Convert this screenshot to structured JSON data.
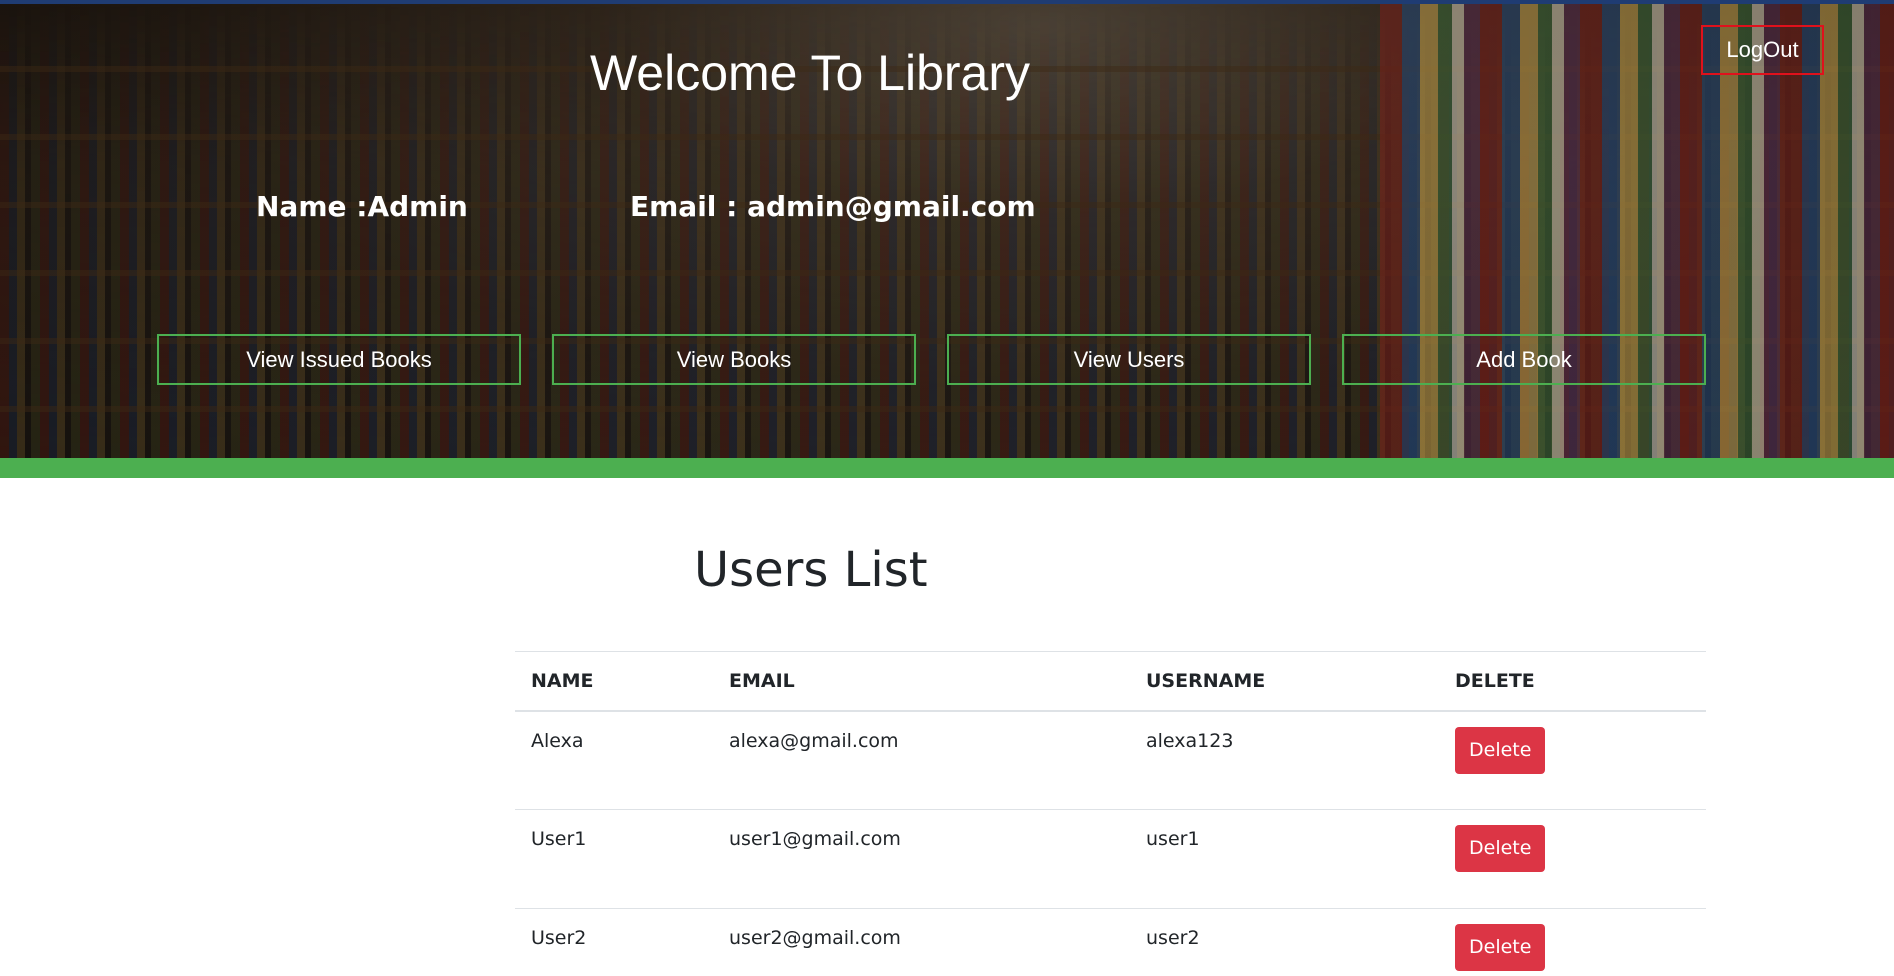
{
  "header": {
    "title": "Welcome To Library",
    "logout_label": "LogOut",
    "name_label": "Name :Admin",
    "email_label": "Email : admin@gmail.com"
  },
  "nav": {
    "view_issued_books": "View Issued Books",
    "view_books": "View Books",
    "view_users": "View Users",
    "add_book": "Add Book"
  },
  "users": {
    "title": "Users List",
    "columns": [
      "NAME",
      "EMAIL",
      "USERNAME",
      "DELETE"
    ],
    "rows": [
      {
        "name": "Alexa",
        "email": "alexa@gmail.com",
        "username": "alexa123",
        "action": "Delete"
      },
      {
        "name": "User1",
        "email": "user1@gmail.com",
        "username": "user1",
        "action": "Delete"
      },
      {
        "name": "User2",
        "email": "user2@gmail.com",
        "username": "user2",
        "action": "Delete"
      }
    ]
  },
  "colors": {
    "accent_green": "#4caf50",
    "logout_red": "#e0111c",
    "delete_red": "#dc3545"
  }
}
